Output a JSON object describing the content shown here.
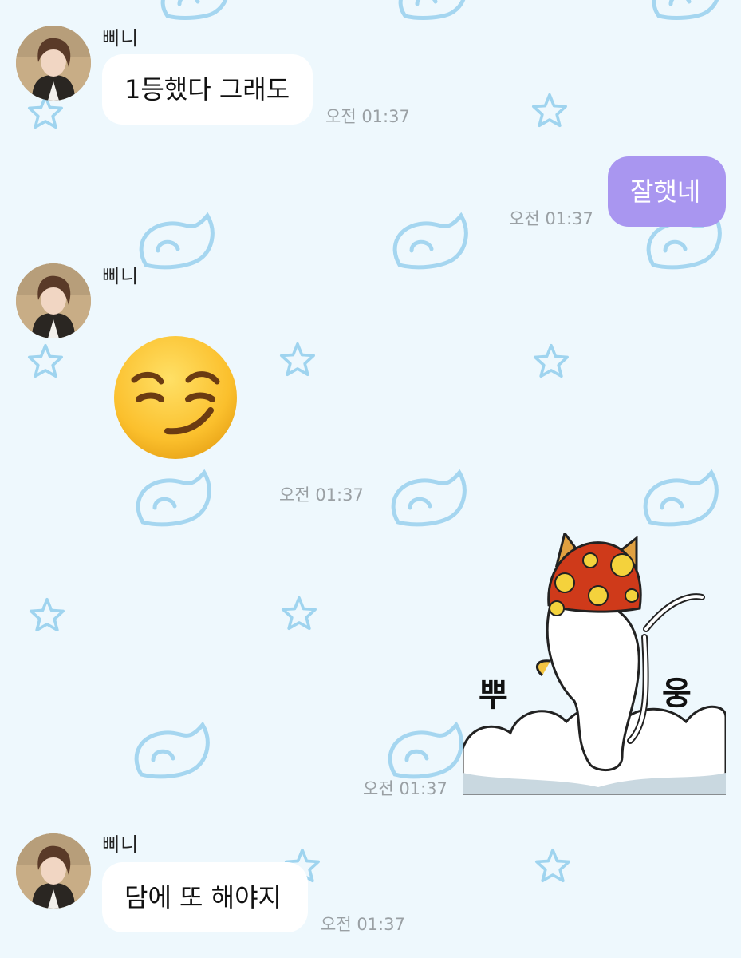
{
  "chat": {
    "contact_name": "삐니",
    "messages": [
      {
        "from": "other",
        "sender": "삐니",
        "text": "1등했다 그래도",
        "time": "오전 01:37"
      },
      {
        "from": "me",
        "text": "잘햇네",
        "time": "오전 01:37"
      },
      {
        "from": "other",
        "sender": "삐니",
        "emoji": "smirking-face",
        "time": "오전 01:37"
      },
      {
        "from": "me",
        "sticker": "cat-with-mushroom-hat",
        "sticker_text_left": "뿌",
        "sticker_text_right": "웅",
        "time": "오전 01:37"
      },
      {
        "from": "other",
        "sender": "삐니",
        "text": "담에 또 해야지",
        "time": "오전 01:37"
      }
    ]
  },
  "colors": {
    "background": "#eef8fd",
    "my_bubble": "#a996f0",
    "other_bubble": "#ffffff",
    "decor": "#9fd4ef"
  }
}
